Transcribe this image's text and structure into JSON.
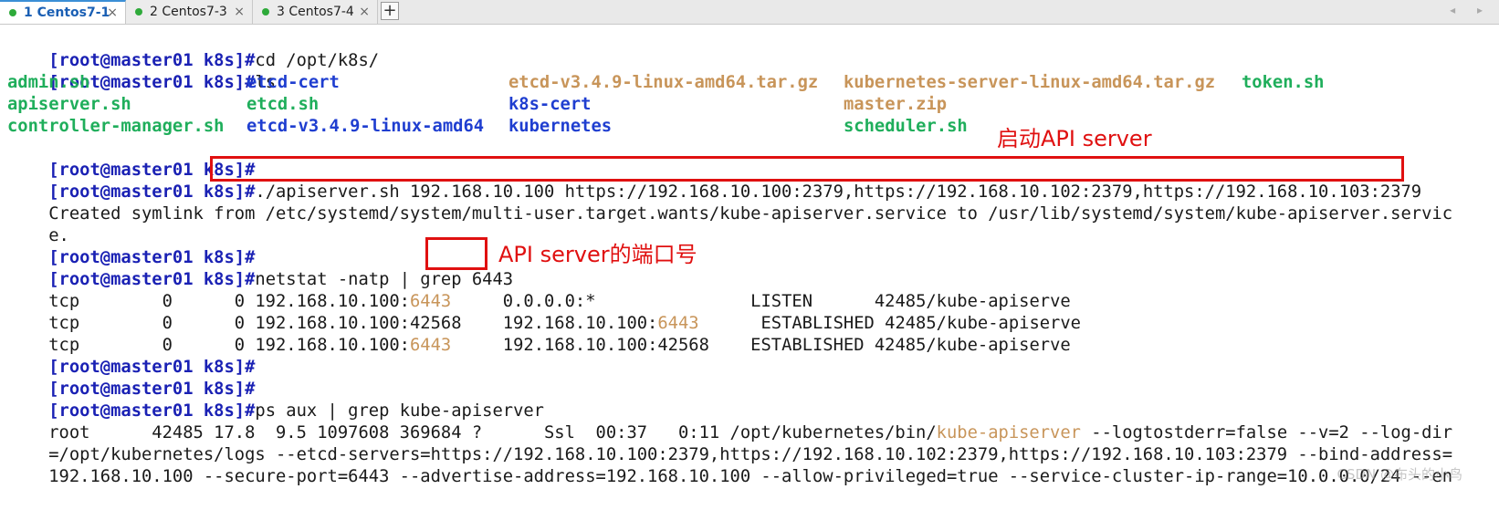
{
  "tabs": [
    {
      "label": "1 Centos7-1",
      "active": true
    },
    {
      "label": "2 Centos7-3",
      "active": false
    },
    {
      "label": "3 Centos7-4",
      "active": false
    }
  ],
  "new_tab_label": "+",
  "close_glyph": "×",
  "nav_arrows": "◂ ▸",
  "prompt": "[root@master01 k8s]#",
  "commands": {
    "cd": "cd /opt/k8s/",
    "ls": "ls",
    "apiserver": "./apiserver.sh 192.168.10.100 https://192.168.10.100:2379,https://192.168.10.102:2379,https://192.168.10.103:2379",
    "netstat_prefix": "netstat -natp | grep ",
    "netstat_port": "6443",
    "ps": "ps aux | grep kube-apiserver"
  },
  "ls_rows": [
    [
      "admin.sh",
      "etcd-cert",
      "etcd-v3.4.9-linux-amd64.tar.gz",
      "kubernetes-server-linux-amd64.tar.gz",
      "token.sh"
    ],
    [
      "apiserver.sh",
      "etcd.sh",
      "k8s-cert",
      "master.zip",
      ""
    ],
    [
      "controller-manager.sh",
      "etcd-v3.4.9-linux-amd64",
      "kubernetes",
      "scheduler.sh",
      ""
    ]
  ],
  "symlink_output": [
    "Created symlink from /etc/systemd/system/multi-user.target.wants/kube-apiserver.service to /usr/lib/systemd/system/kube-apiserver.servic",
    "e."
  ],
  "netstat_rows": [
    {
      "pre": "tcp        0      0 192.168.10.100:",
      "p1": "6443",
      "mid": "     0.0.0.0:*               ",
      "p2": "",
      "post": "LISTEN      42485/kube-apiserve"
    },
    {
      "pre": "tcp        0      0 192.168.10.100:42568    192.168.10.100:",
      "p1": "6443",
      "mid": "      ",
      "p2": "",
      "post": "ESTABLISHED 42485/kube-apiserve"
    },
    {
      "pre": "tcp        0      0 192.168.10.100:",
      "p1": "6443",
      "mid": "     192.168.10.100:42568    ",
      "p2": "",
      "post": "ESTABLISHED 42485/kube-apiserve"
    }
  ],
  "ps_output": {
    "line1_pre": "root      42485 17.8  9.5 1097608 369684 ?      Ssl  00:37   0:11 /opt/kubernetes/bin/",
    "line1_hl": "kube-apiserver",
    "line1_post": " --logtostderr=false --v=2 --log-dir",
    "line2": "=/opt/kubernetes/logs --etcd-servers=https://192.168.10.100:2379,https://192.168.10.102:2379,https://192.168.10.103:2379 --bind-address=",
    "line3": "192.168.10.100 --secure-port=6443 --advertise-address=192.168.10.100 --allow-privileged=true --service-cluster-ip-range=10.0.0.0/24 --en"
  },
  "annotations": {
    "start_api": "启动API server",
    "api_port": "API server的端口号"
  },
  "watermark": "CSDN @布头的小鸟",
  "colors": {
    "prompt": "#1a21b4",
    "green_file": "#1fae5b",
    "blue_dir": "#1f3ed0",
    "archive": "#c8955a",
    "annotation_red": "#e01010",
    "tab_active": "#1a5fb4"
  }
}
